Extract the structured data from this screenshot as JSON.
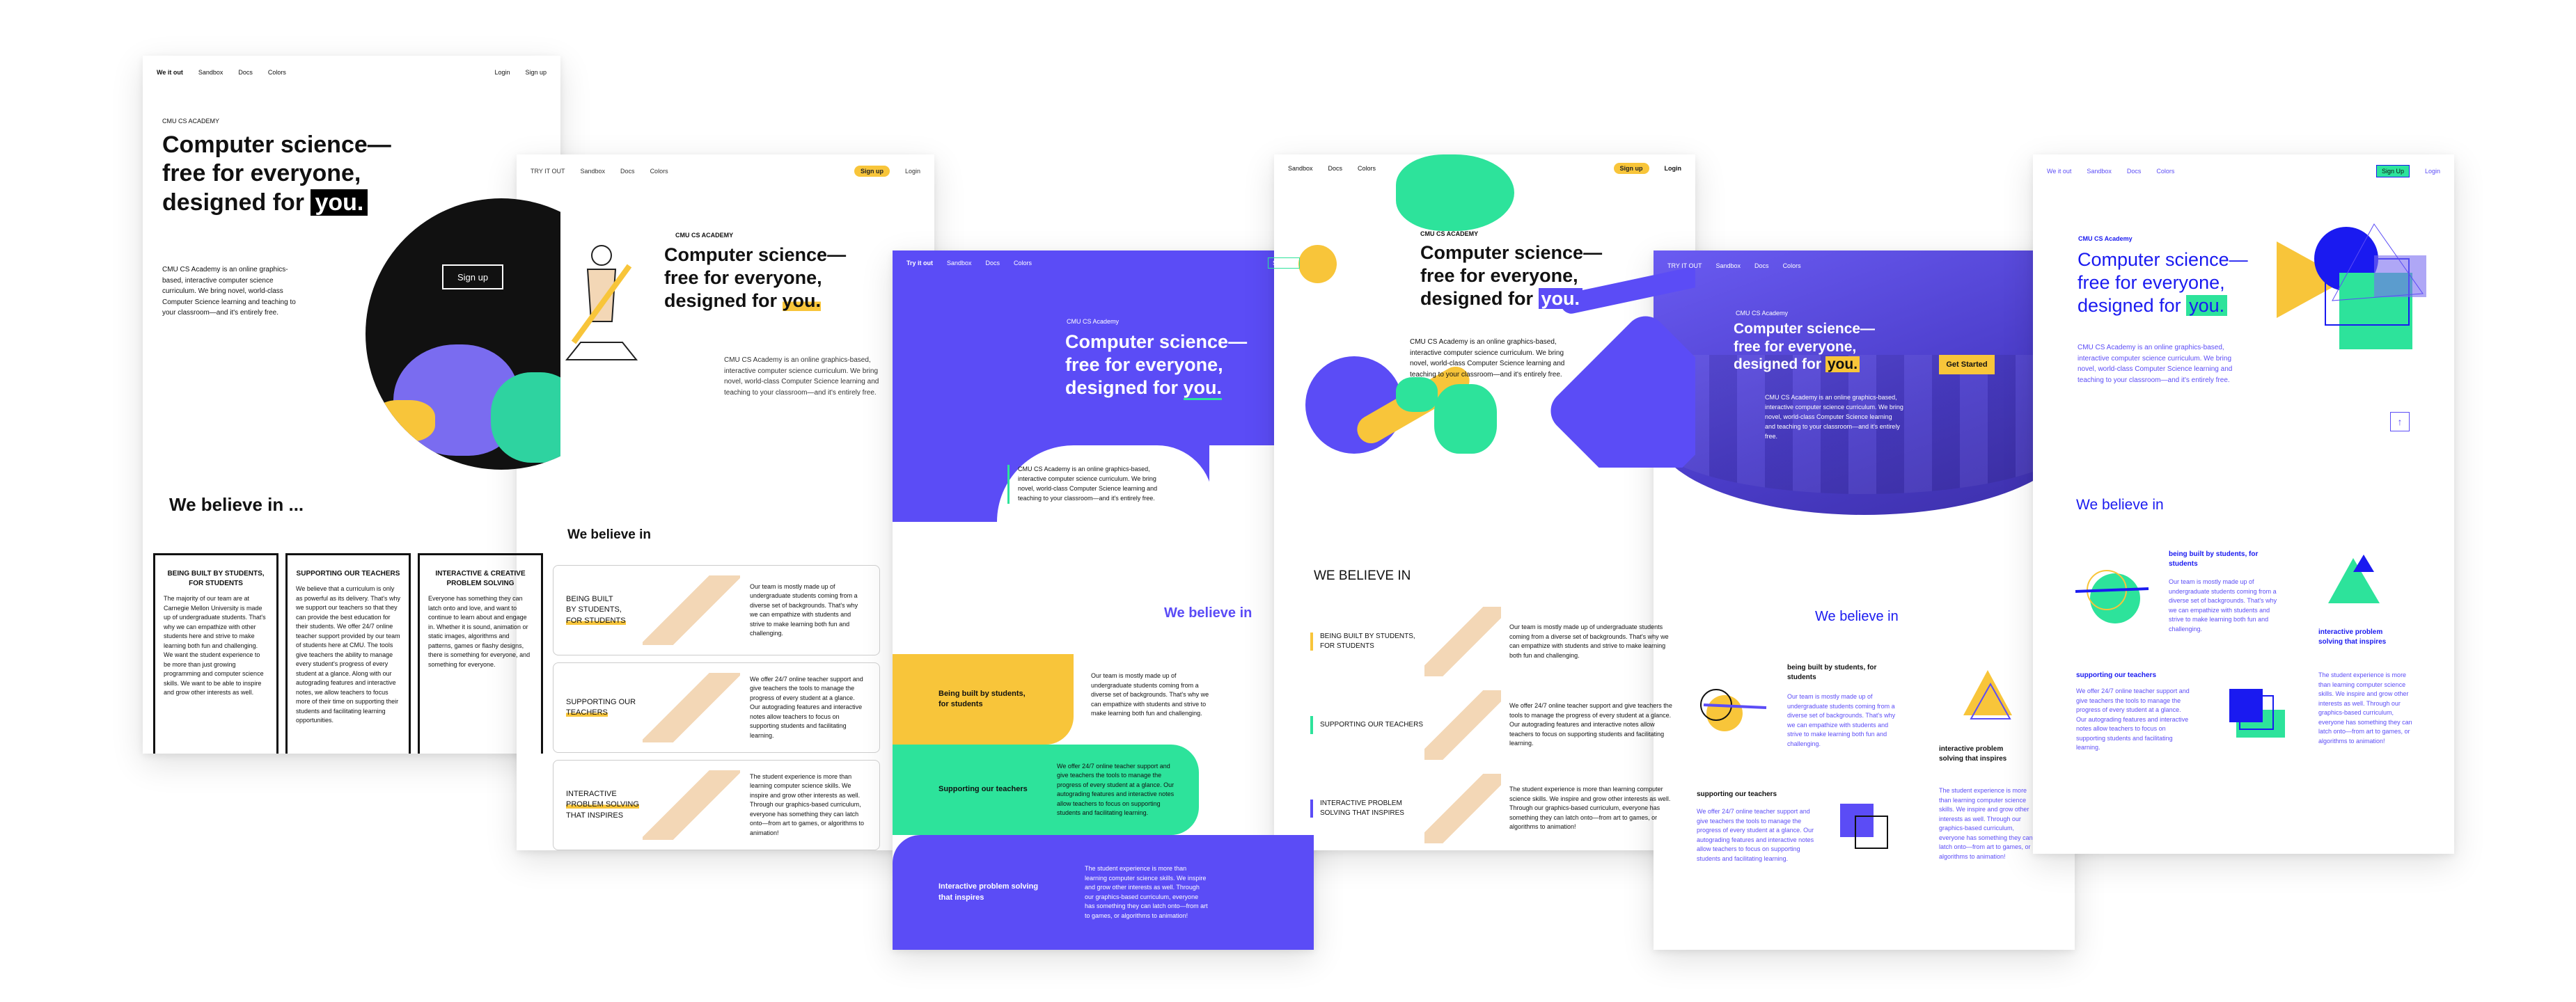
{
  "headline": {
    "line1": "Computer science—",
    "line2": "free for everyone,",
    "line3_prefix": "designed for ",
    "line3_mark": "you."
  },
  "brand": {
    "academy": "CMU CS ACADEMY",
    "academy_alt": "CMU CS Academy"
  },
  "nav": {
    "try": "TRY IT OUT",
    "try_alt": "Try it out",
    "try_alt2": "We it out",
    "sandbox": "Sandbox",
    "docs": "Docs",
    "colors": "Colors",
    "login": "Login",
    "signup": "Sign up",
    "signup_alt": "Sign Up"
  },
  "intro": "CMU CS Academy is an online graphics-based, interactive computer science curriculum. We bring novel, world-class Computer Science learning and teaching to your classroom—and it's entirely free.",
  "buttons": {
    "signup": "Sign up",
    "get_started": "Get Started"
  },
  "believe": {
    "v1": "We believe in ...",
    "v2": "We believe in",
    "v3": "WE BELIEVE IN"
  },
  "values": [
    {
      "title": "BEING BUILT BY STUDENTS, FOR STUDENTS",
      "body": "Our team is mostly made up of undergraduate students coming from a diverse set of backgrounds. That's why we can empathize with students and strive to make learning both fun and challenging."
    },
    {
      "title": "SUPPORTING OUR TEACHERS",
      "body": "We offer 24/7 online teacher support and give teachers the tools to manage the progress of every student at a glance. Our autograding features and interactive notes allow teachers to focus on supporting students and facilitating learning."
    },
    {
      "title": "INTERACTIVE & CREATIVE PROBLEM SOLVING",
      "body": "The student experience is more than learning computer science skills. We inspire and grow other interests as well. Through our graphics-based curriculum, everyone has something they can latch onto—from art to games, or algorithms to animation!"
    }
  ],
  "v1_values": [
    {
      "title": "BEING BUILT BY STUDENTS, FOR STUDENTS",
      "body": "The majority of our team are at Carnegie Mellon University is made up of undergraduate students. That's why we can empathize with other students here and strive to make learning both fun and challenging. We want the student experience to be more than just growing programming and computer science skills. We want to be able to inspire and grow other interests as well."
    },
    {
      "title": "SUPPORTING OUR TEACHERS",
      "body": "We believe that a curriculum is only as powerful as its delivery. That's why we support our teachers so that they can provide the best education for their students. We offer 24/7 online teacher support provided by our team of students here at CMU. The tools give teachers the ability to manage every student's progress of every student at a glance. Along with our autograding features and interactive notes, we allow teachers to focus more of their time on supporting their students and facilitating learning opportunities."
    },
    {
      "title": "INTERACTIVE & CREATIVE PROBLEM SOLVING",
      "body": "Everyone has something they can latch onto and love, and want to continue to learn about and engage in. Whether it is sound, animation or static images, algorithms and patterns, games or flashy designs, there is something for everyone, and something for everyone."
    }
  ],
  "short_titles": {
    "built1": "BEING BUILT",
    "built2": "BY STUDENTS,",
    "built3": "FOR STUDENTS",
    "support1": "SUPPORTING OUR",
    "support2": "TEACHERS",
    "inter1": "INTERACTIVE",
    "inter2": "PROBLEM SOLVING",
    "inter3": "THAT INSPIRES"
  },
  "v3_titles": {
    "built": "Being built by students, for students",
    "support": "Supporting our teachers",
    "inter": "Interactive problem solving that inspires"
  },
  "v4_titles": {
    "built": "BEING BUILT BY STUDENTS, FOR STUDENTS",
    "support": "SUPPORTING OUR TEACHERS",
    "inter": "INTERACTIVE PROBLEM SOLVING THAT INSPIRES"
  },
  "v5_titles": {
    "built": "being built by students, for students",
    "support": "supporting our teachers",
    "inter": "interactive problem solving that inspires"
  },
  "colors": {
    "purple": "#5b4cf6",
    "green": "#2de39b",
    "yellow": "#f8c53a",
    "blue": "#1a1af0"
  }
}
